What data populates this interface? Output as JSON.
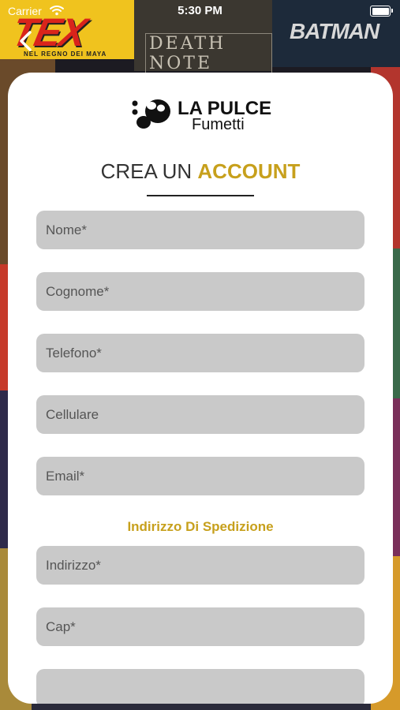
{
  "status_bar": {
    "carrier": "Carrier",
    "time": "5:30 PM"
  },
  "background_covers": {
    "cover_1_title": "TEX",
    "cover_1_subtitle": "NEL REGNO DEI MAYA",
    "cover_2_title": "DEATH NOTE",
    "cover_3_title": "BATMAN"
  },
  "brand": {
    "name": "LA PULCE",
    "subtitle": "Fumetti"
  },
  "form": {
    "title_light": "CREA UN ",
    "title_bold": "ACCOUNT",
    "fields": [
      {
        "placeholder": "Nome*",
        "value": ""
      },
      {
        "placeholder": "Cognome*",
        "value": ""
      },
      {
        "placeholder": "Telefono*",
        "value": ""
      },
      {
        "placeholder": "Cellulare",
        "value": ""
      },
      {
        "placeholder": "Email*",
        "value": ""
      }
    ],
    "shipping_section": "Indirizzo Di Spedizione",
    "shipping_fields": [
      {
        "placeholder": "Indirizzo*",
        "value": ""
      },
      {
        "placeholder": "Cap*",
        "value": ""
      },
      {
        "placeholder": "",
        "value": ""
      }
    ]
  },
  "colors": {
    "accent": "#c7a01c",
    "field_bg": "#c9c9c9",
    "card_bg": "#ffffff"
  }
}
